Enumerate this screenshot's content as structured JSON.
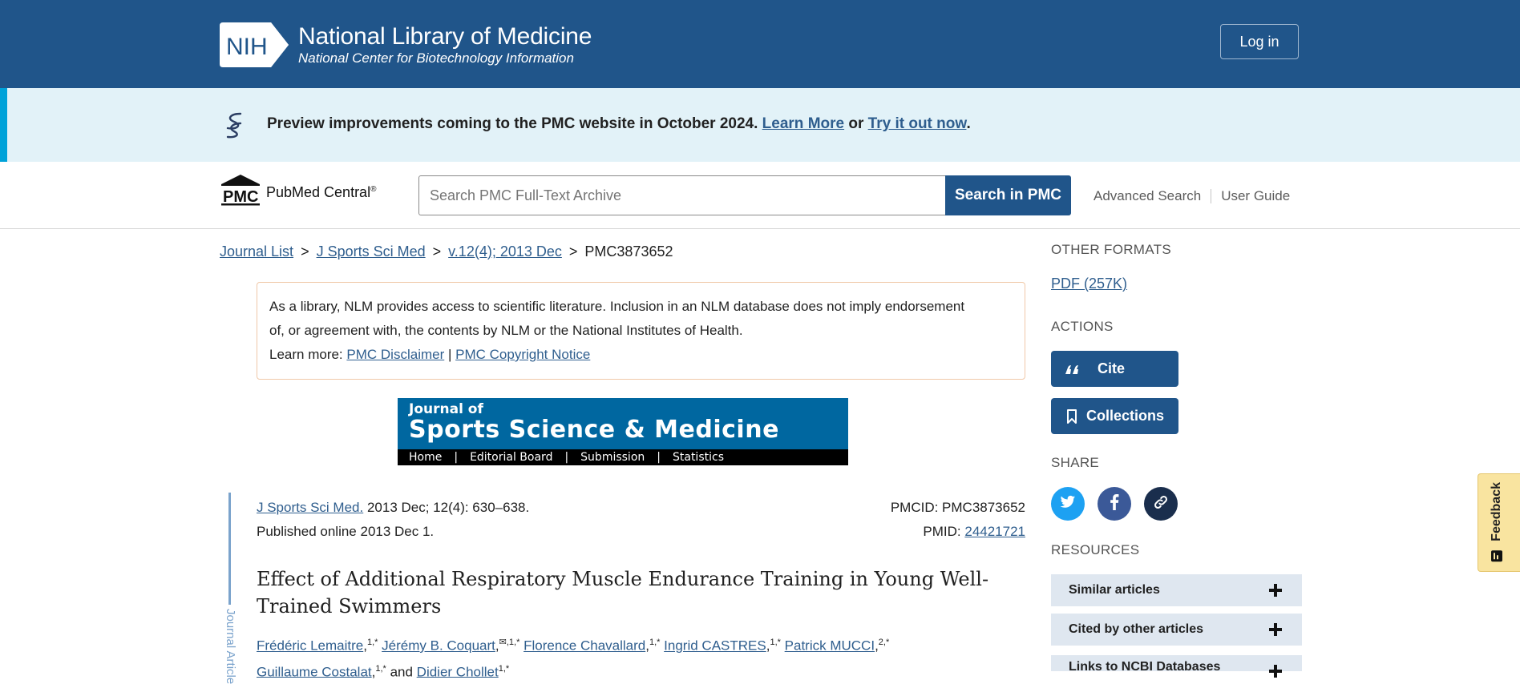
{
  "header": {
    "logo_text": "NIH",
    "title": "National Library of Medicine",
    "subtitle": "National Center for Biotechnology Information",
    "login_label": "Log in"
  },
  "banner": {
    "text": "Preview improvements coming to the PMC website in October 2024.",
    "learn_more": "Learn More",
    "or": "or",
    "try_it": "Try it out now",
    "end": "."
  },
  "search": {
    "brand_mark": "PMC",
    "brand_name": "PubMed Central",
    "brand_reg": "®",
    "placeholder": "Search PMC Full-Text Archive",
    "button_label": "Search in PMC",
    "advanced": "Advanced Search",
    "guide": "User Guide"
  },
  "breadcrumb": {
    "items": [
      "Journal List",
      "J Sports Sci Med",
      "v.12(4); 2013 Dec"
    ],
    "current": "PMC3873652",
    "sep": ">"
  },
  "disclaimer": {
    "line1": "As a library, NLM provides access to scientific literature. Inclusion in an NLM database does not imply endorsement",
    "line2": "of, or agreement with, the contents by NLM or the National Institutes of Health.",
    "learn_more": "Learn more:",
    "link1": "PMC Disclaimer",
    "pipe": "|",
    "link2": "PMC Copyright Notice"
  },
  "journal_banner": {
    "top": "Journal of",
    "main": "Sports Science & Medicine",
    "nav": [
      "Home",
      "Editorial Board",
      "Submission",
      "Statistics"
    ],
    "pipe": "|"
  },
  "citation": {
    "journal_link": "J Sports Sci Med.",
    "details": "2013 Dec; 12(4): 630–638.",
    "published": "Published online 2013 Dec 1.",
    "pmcid": "PMCID: PMC3873652",
    "pmid_label": "PMID:",
    "pmid": "24421721",
    "side_label": "Journal Article"
  },
  "article": {
    "title": "Effect of Additional Respiratory Muscle Endurance Training in Young Well-Trained Swimmers",
    "authors": [
      {
        "name": "Frédéric Lemaitre",
        "sup": "1,*"
      },
      {
        "name": "Jérémy B. Coquart",
        "sup": "✉,1,*"
      },
      {
        "name": "Florence Chavallard",
        "sup": "1,*"
      },
      {
        "name": "Ingrid CASTRES",
        "sup": "1,*"
      },
      {
        "name": "Patrick MUCCI",
        "sup": "2,*"
      },
      {
        "name": "Guillaume Costalat",
        "sup": "1,*"
      },
      {
        "name": "Didier Chollet",
        "sup": "1,*"
      }
    ],
    "and": "and"
  },
  "sidebar": {
    "other_formats": "OTHER FORMATS",
    "pdf": "PDF (257K)",
    "actions": "ACTIONS",
    "cite": "Cite",
    "collections": "Collections",
    "share": "SHARE",
    "resources": "RESOURCES",
    "resource_items": [
      "Similar articles",
      "Cited by other articles",
      "Links to NCBI Databases"
    ]
  },
  "feedback": {
    "label": "Feedback"
  },
  "colors": {
    "primary": "#20558a",
    "link": "#2f5e8e",
    "banner_bg": "#e2f2f8",
    "accent": "#00a2d9",
    "twitter": "#1da1f2",
    "facebook": "#3b5998",
    "link_share": "#1a2e4d"
  }
}
